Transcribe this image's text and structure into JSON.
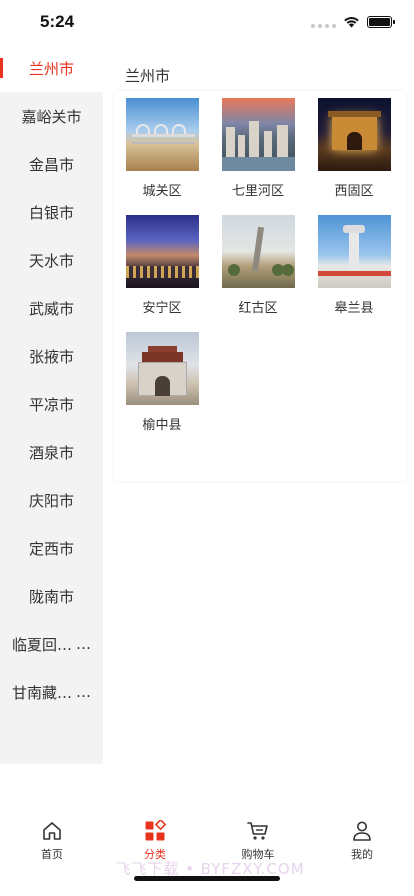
{
  "status_bar": {
    "time": "5:24"
  },
  "sidebar": {
    "items": [
      {
        "label": "兰州市",
        "active": true
      },
      {
        "label": "嘉峪关市",
        "active": false
      },
      {
        "label": "金昌市",
        "active": false
      },
      {
        "label": "白银市",
        "active": false
      },
      {
        "label": "天水市",
        "active": false
      },
      {
        "label": "武威市",
        "active": false
      },
      {
        "label": "张掖市",
        "active": false
      },
      {
        "label": "平凉市",
        "active": false
      },
      {
        "label": "酒泉市",
        "active": false
      },
      {
        "label": "庆阳市",
        "active": false
      },
      {
        "label": "定西市",
        "active": false
      },
      {
        "label": "陇南市",
        "active": false
      },
      {
        "label": "临夏回族自治州",
        "active": false
      },
      {
        "label": "甘南藏族自治州",
        "active": false
      }
    ]
  },
  "main": {
    "title": "兰州市",
    "districts": [
      {
        "label": "城关区",
        "image": "bridge-river-photo"
      },
      {
        "label": "七里河区",
        "image": "city-sunset-photo"
      },
      {
        "label": "西固区",
        "image": "night-gate-photo"
      },
      {
        "label": "安宁区",
        "image": "city-night-aerial-photo"
      },
      {
        "label": "红古区",
        "image": "monument-park-photo"
      },
      {
        "label": "皋兰县",
        "image": "white-tower-photo"
      },
      {
        "label": "榆中县",
        "image": "city-gate-tower-photo"
      }
    ]
  },
  "tabbar": {
    "tabs": [
      {
        "label": "首页",
        "icon": "home-icon",
        "active": false
      },
      {
        "label": "分类",
        "icon": "category-icon",
        "active": true
      },
      {
        "label": "购物车",
        "icon": "cart-icon",
        "active": false
      },
      {
        "label": "我的",
        "icon": "user-icon",
        "active": false
      }
    ]
  },
  "colors": {
    "accent": "#e8341f",
    "sidebar_bg": "#f3f3f3"
  },
  "watermark": "飞飞下载 • BYFZXY.COM"
}
